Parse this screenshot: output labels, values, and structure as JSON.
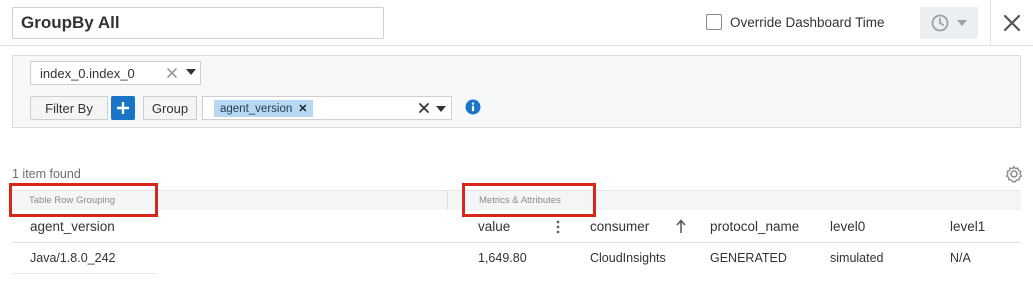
{
  "header": {
    "title_value": "GroupBy All",
    "override_label": "Override Dashboard Time"
  },
  "query": {
    "metric_value": "index_0.index_0",
    "filter_label": "Filter By",
    "group_label": "Group",
    "group_tag": "agent_version"
  },
  "results": {
    "items_found": "1 item found",
    "section_grouping": "Table Row Grouping",
    "section_metrics": "Metrics & Attributes",
    "columns": [
      "agent_version",
      "value",
      "consumer",
      "protocol_name",
      "level0",
      "level1"
    ],
    "rows": [
      [
        "Java/1.8.0_242",
        "1,649.80",
        "CloudInsights",
        "GENERATED",
        "simulated",
        "N/A"
      ]
    ]
  },
  "colors": {
    "accent": "#1a74c7",
    "tag_bg": "#b6d8f2",
    "highlight_box": "#d9261c"
  },
  "icons": [
    "clock-icon",
    "chevron-down-icon",
    "close-icon",
    "clear-icon",
    "plus-icon",
    "info-icon",
    "sort-up-icon",
    "kebab-icon",
    "gear-icon"
  ]
}
